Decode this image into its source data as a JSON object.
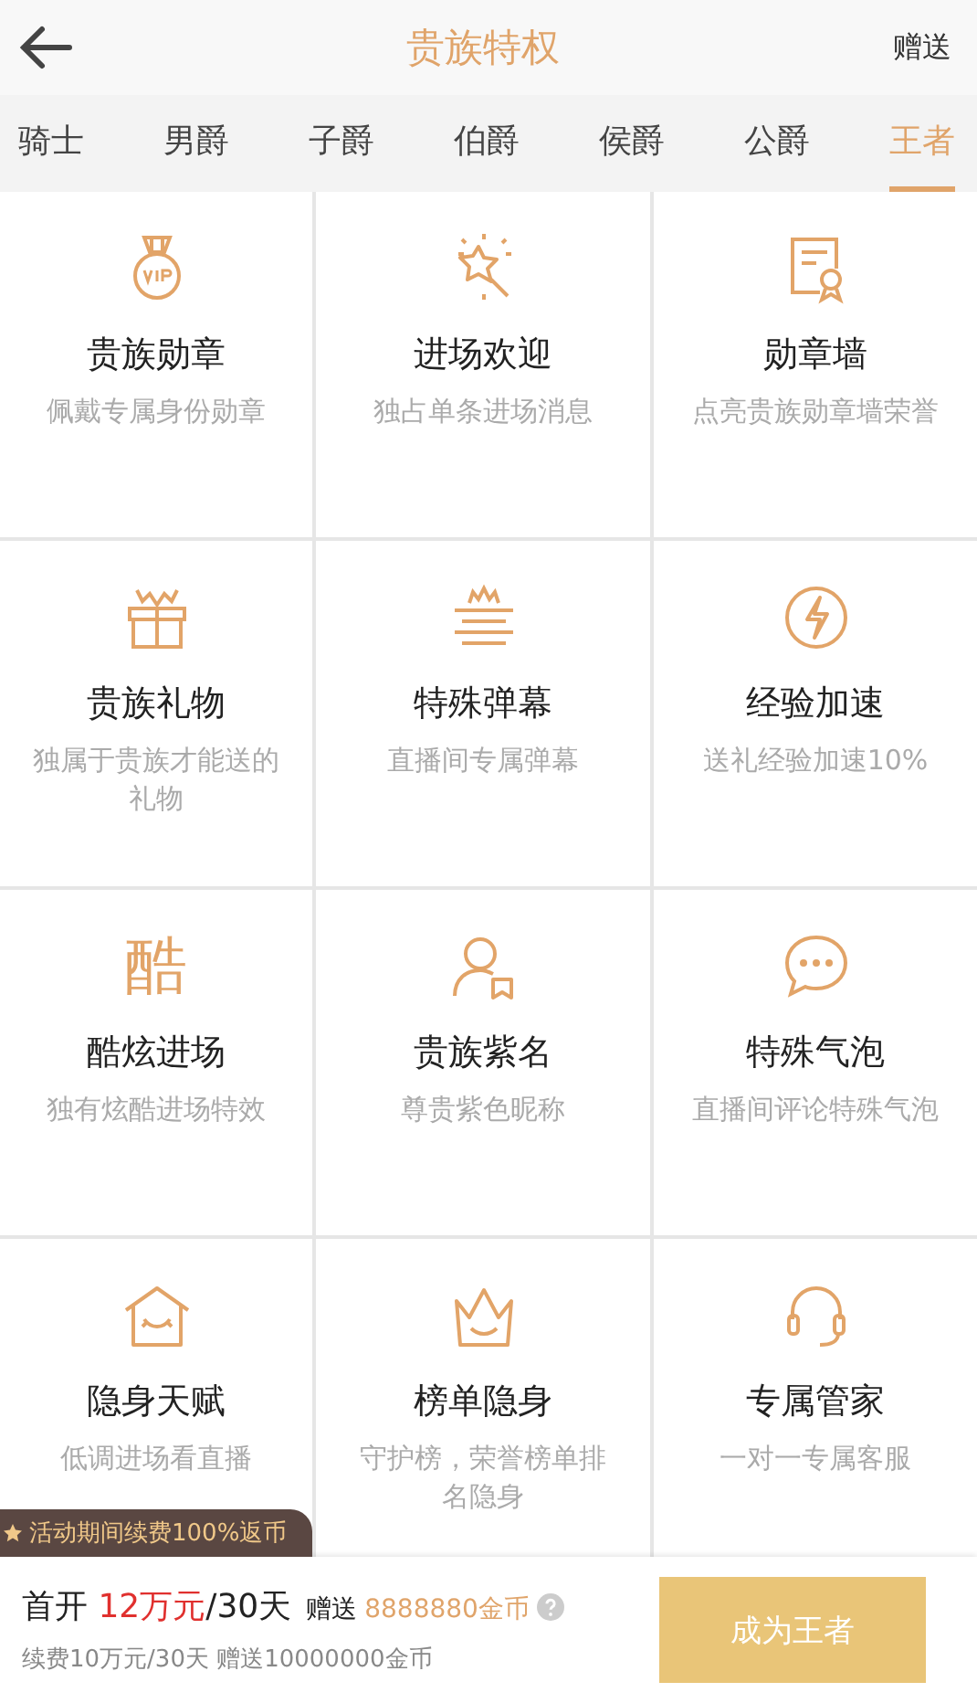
{
  "header": {
    "title": "贵族特权",
    "action": "赠送"
  },
  "tabs": [
    {
      "label": "骑士",
      "selected": false
    },
    {
      "label": "男爵",
      "selected": false
    },
    {
      "label": "子爵",
      "selected": false
    },
    {
      "label": "伯爵",
      "selected": false
    },
    {
      "label": "侯爵",
      "selected": false
    },
    {
      "label": "公爵",
      "selected": false
    },
    {
      "label": "王者",
      "selected": true
    }
  ],
  "privileges": [
    {
      "kind": "medal",
      "title": "贵族勋章",
      "desc": "佩戴专属身份勋章"
    },
    {
      "kind": "wand",
      "title": "进场欢迎",
      "desc": "独占单条进场消息"
    },
    {
      "kind": "certificate",
      "title": "勋章墙",
      "desc": "点亮贵族勋章墙荣誉"
    },
    {
      "kind": "gift",
      "title": "贵族礼物",
      "desc": "独属于贵族才能送的礼物"
    },
    {
      "kind": "barrage",
      "title": "特殊弹幕",
      "desc": "直播间专属弹幕"
    },
    {
      "kind": "bolt",
      "title": "经验加速",
      "desc": "送礼经验加速10%"
    },
    {
      "kind": "glyph",
      "glyph": "酷",
      "title": "酷炫进场",
      "desc": "独有炫酷进场特效"
    },
    {
      "kind": "user",
      "title": "贵族紫名",
      "desc": "尊贵紫色昵称"
    },
    {
      "kind": "chat",
      "title": "特殊气泡",
      "desc": "直播间评论特殊气泡"
    },
    {
      "kind": "house",
      "title": "隐身天赋",
      "desc": "低调进场看直播"
    },
    {
      "kind": "crown",
      "title": "榜单隐身",
      "desc": "守护榜，荣誉榜单排名隐身"
    },
    {
      "kind": "headset",
      "title": "专属管家",
      "desc": "一对一专属客服"
    }
  ],
  "promo": "活动期间续费100%返币",
  "offer": {
    "prefix": "首开",
    "price": "12万元",
    "period": "/30天",
    "gift_label": "赠送",
    "gift": "8888880金币",
    "renew": "续费10万元/30天 赠送10000000金币",
    "button": "成为王者"
  }
}
